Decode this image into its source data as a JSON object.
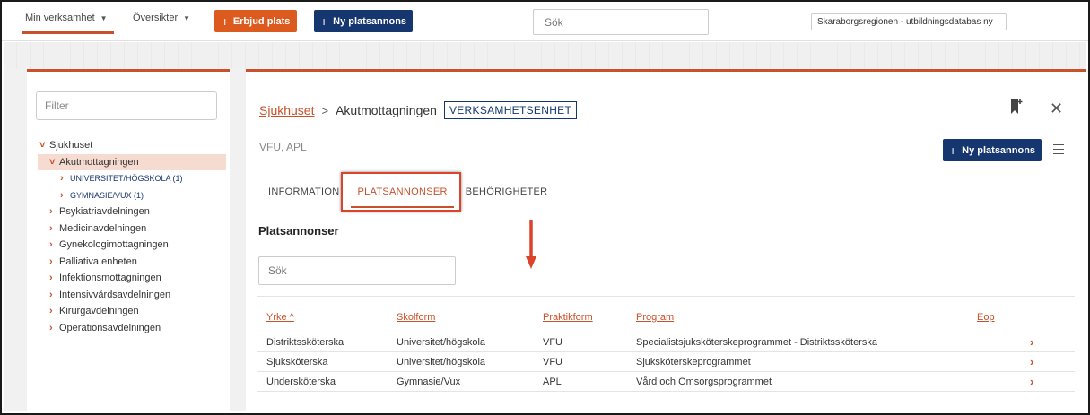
{
  "topbar": {
    "menu_verksamhet": "Min verksamhet",
    "menu_oversikter": "Översikter",
    "erbjud_plats": "Erbjud plats",
    "ny_platsannons": "Ny platsannons",
    "search_placeholder": "Sök",
    "region_selected": "Skaraborgsregionen - utbildningsdatabas ny"
  },
  "sidebar": {
    "filter_placeholder": "Filter",
    "tree": [
      {
        "label": "Sjukhuset",
        "chevron": "˅"
      },
      {
        "label": "Akutmottagningen",
        "chevron": "˅"
      },
      {
        "label": "UNIVERSITET/HÖGSKOLA (1)",
        "chevron": "›"
      },
      {
        "label": "GYMNASIE/VUX (1)",
        "chevron": "›"
      },
      {
        "label": "Psykiatriavdelningen",
        "chevron": "›"
      },
      {
        "label": "Medicinavdelningen",
        "chevron": "›"
      },
      {
        "label": "Gynekologimottagningen",
        "chevron": "›"
      },
      {
        "label": "Palliativa enheten",
        "chevron": "›"
      },
      {
        "label": "Infektionsmottagningen",
        "chevron": "›"
      },
      {
        "label": "Intensivvårdsavdelningen",
        "chevron": "›"
      },
      {
        "label": "Kirurgavdelningen",
        "chevron": "›"
      },
      {
        "label": "Operationsavdelningen",
        "chevron": "›"
      }
    ]
  },
  "main": {
    "breadcrumb_parent": "Sjukhuset",
    "breadcrumb_sep": ">",
    "breadcrumb_current": "Akutmottagningen",
    "badge": "VERKSAMHETSENHET",
    "subtitle": "VFU, APL",
    "ny_platsannons": "Ny platsannons",
    "tabs": [
      "INFORMATION",
      "PLATSANNONSER",
      "BEHÖRIGHETER"
    ],
    "section_title": "Platsannonser",
    "search_placeholder": "Sök",
    "table": {
      "headers": [
        "Yrke ^",
        "Skolform",
        "Praktikform",
        "Program",
        "Eop"
      ],
      "rows": [
        [
          "Distriktssköterska",
          "Universitet/högskola",
          "VFU",
          "Specialistsjuksköterskeprogrammet - Distriktssköterska",
          ""
        ],
        [
          "Sjuksköterska",
          "Universitet/högskola",
          "VFU",
          "Sjuksköterskeprogrammet",
          ""
        ],
        [
          "Undersköterska",
          "Gymnasie/Vux",
          "APL",
          "Vård och Omsorgsprogrammet",
          ""
        ]
      ]
    }
  },
  "colors": {
    "accent": "#c8502a",
    "navy": "#16366f",
    "orange_button": "#dd5a1f",
    "highlight": "#d9442a"
  }
}
